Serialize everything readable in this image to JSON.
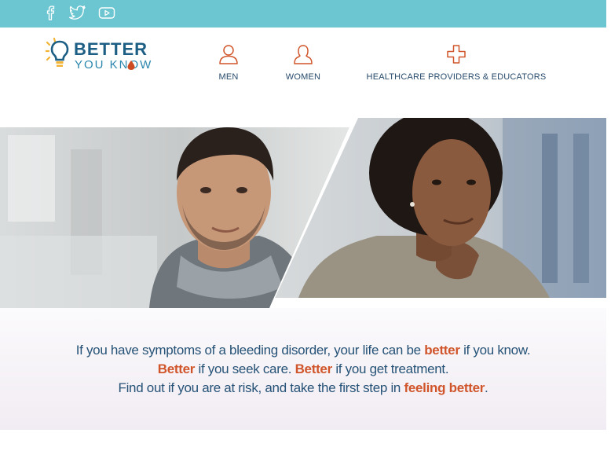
{
  "social": {
    "facebook": "facebook-icon",
    "twitter": "twitter-icon",
    "youtube": "youtube-icon"
  },
  "logo": {
    "line1": "BETTER",
    "line2": "YOU KNOW"
  },
  "nav": [
    {
      "label": "MEN",
      "icon": "person-icon"
    },
    {
      "label": "WOMEN",
      "icon": "person-icon"
    },
    {
      "label": "HEALTHCARE PROVIDERS & EDUCATORS",
      "icon": "medical-cross-icon"
    }
  ],
  "hero": {
    "images": [
      "photo-man",
      "photo-woman"
    ]
  },
  "tagline": {
    "line1_a": "If you have symptoms of a bleeding disorder, your life can be ",
    "line1_b": "better",
    "line1_c": " if you know.",
    "line2_a": "Better",
    "line2_b": " if you seek care. ",
    "line2_c": "Better",
    "line2_d": " if you get treatment.",
    "line3_a": "Find out if you are at risk, and take the first step in ",
    "line3_b": "feeling better",
    "line3_c": "."
  },
  "colors": {
    "topbar": "#6cc6d1",
    "brand_blue": "#255276",
    "accent_orange": "#d0552a"
  }
}
